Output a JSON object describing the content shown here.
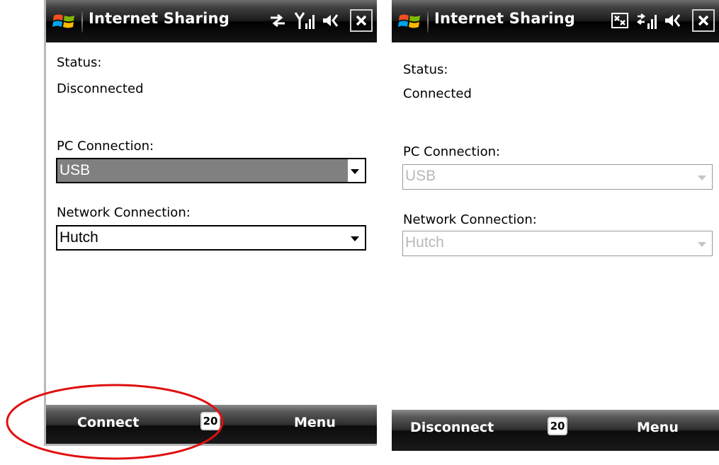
{
  "colors": {
    "titlebar": "#000000",
    "softbar": "#1a1a1a",
    "selection": "#808080",
    "disabled_text": "#b8b8b8",
    "annotation": "#e01010"
  },
  "left_screen": {
    "title": "Internet Sharing",
    "status_label": "Status:",
    "status_value": "Disconnected",
    "pc_connection_label": "PC Connection:",
    "pc_connection_value": "USB",
    "network_connection_label": "Network Connection:",
    "network_connection_value": "Hutch",
    "left_softkey": "Connect",
    "center_icon_text": "20",
    "right_softkey": "Menu",
    "status_icons": [
      "data-sync-icon",
      "signal-strength-icon",
      "speaker-icon",
      "close-icon"
    ]
  },
  "right_screen": {
    "title": "Internet Sharing",
    "status_label": "Status:",
    "status_value": "Connected",
    "pc_connection_label": "PC Connection:",
    "pc_connection_value": "USB",
    "network_connection_label": "Network Connection:",
    "network_connection_value": "Hutch",
    "left_softkey": "Disconnect",
    "center_icon_text": "20",
    "right_softkey": "Menu",
    "status_icons": [
      "internet-sharing-icon",
      "signal-data-icon",
      "speaker-icon",
      "close-icon"
    ]
  },
  "annotation": {
    "shape": "ellipse",
    "target": "Connect"
  }
}
